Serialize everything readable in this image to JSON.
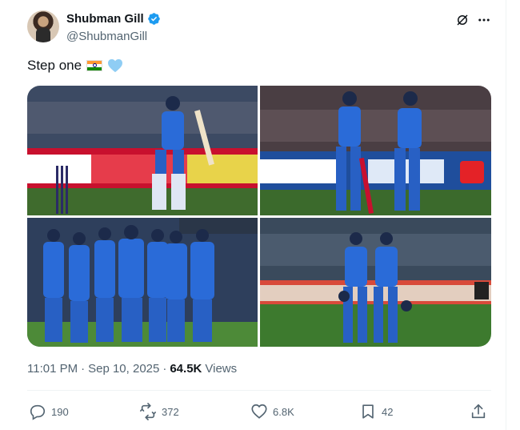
{
  "author": {
    "display_name": "Shubman Gill",
    "handle": "@ShubmanGill",
    "verified": true
  },
  "tweet": {
    "text": "Step one",
    "emojis": [
      "india-flag",
      "light-blue-heart"
    ]
  },
  "media": [
    {
      "kind": "photo"
    },
    {
      "kind": "photo"
    },
    {
      "kind": "photo"
    },
    {
      "kind": "photo"
    }
  ],
  "meta": {
    "time": "11:01 PM",
    "separator": "·",
    "date": "Sep 10, 2025",
    "views_count": "64.5K",
    "views_label": "Views"
  },
  "actions": {
    "replies": "190",
    "reposts": "372",
    "likes": "6.8K",
    "bookmarks": "42"
  },
  "colors": {
    "text_primary": "#0f1419",
    "text_secondary": "#536471",
    "verified_blue": "#1d9bf0",
    "divider": "#eff3f4"
  }
}
